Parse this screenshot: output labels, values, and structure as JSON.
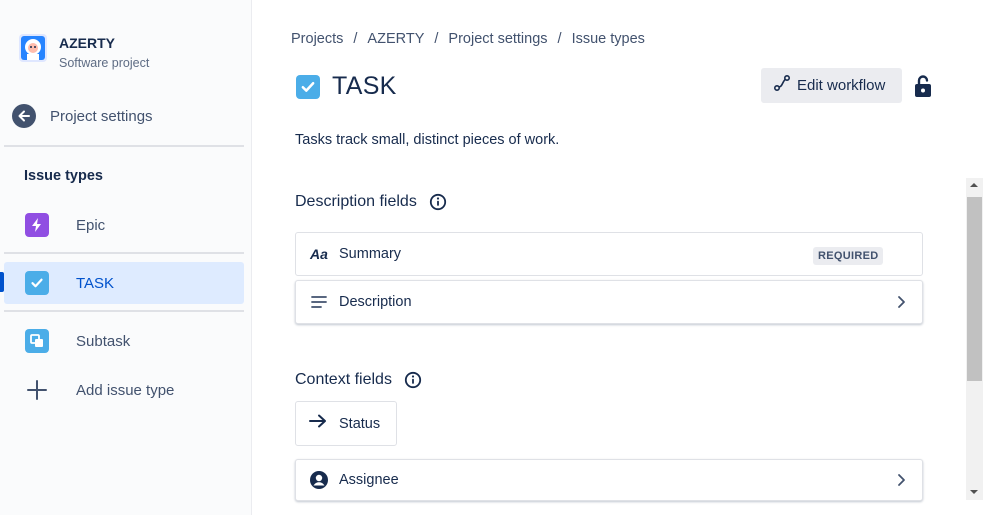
{
  "project": {
    "name": "AZERTY",
    "type": "Software project",
    "avatar_icon": "yeti-avatar-icon"
  },
  "back": {
    "label": "Project settings"
  },
  "sidebar": {
    "section_title": "Issue types",
    "items": [
      {
        "label": "Epic",
        "icon": "epic-icon",
        "color": "#904ee2"
      },
      {
        "label": "TASK",
        "icon": "task-icon",
        "color": "#4bade8",
        "active": true
      },
      {
        "label": "Subtask",
        "icon": "subtask-icon",
        "color": "#4bade8"
      },
      {
        "label": "Add issue type",
        "icon": "plus-icon"
      }
    ]
  },
  "breadcrumb": [
    "Projects",
    "AZERTY",
    "Project settings",
    "Issue types"
  ],
  "page": {
    "title": "TASK",
    "description": "Tasks track small, distinct pieces of work.",
    "edit_workflow_label": "Edit workflow"
  },
  "description_fields": {
    "title": "Description fields",
    "items": [
      {
        "label": "Summary",
        "icon": "text-style-icon",
        "icon_text": "Aa",
        "badge": "REQUIRED"
      },
      {
        "label": "Description",
        "icon": "align-left-icon"
      }
    ]
  },
  "context_fields": {
    "title": "Context fields",
    "status_label": "Status",
    "items": [
      {
        "label": "Assignee",
        "icon": "person-icon"
      }
    ]
  },
  "colors": {
    "accent": "#0052cc",
    "active_bg": "#deebff",
    "text": "#172b4d",
    "subtle": "#42526e"
  }
}
